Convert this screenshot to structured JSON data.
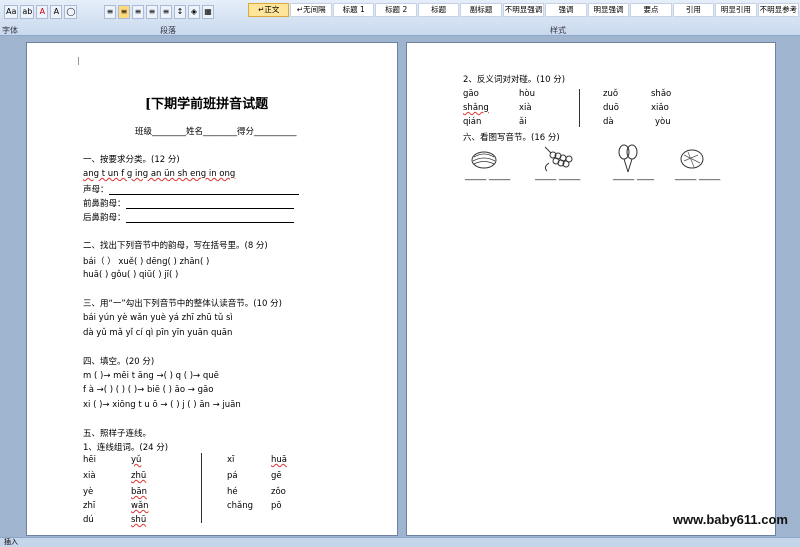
{
  "ribbon": {
    "group_font": "字体",
    "group_para": "段落",
    "group_styles": "样式",
    "font_tools": [
      "Aa",
      "ab",
      "A",
      "A"
    ],
    "styles": [
      "↵正文",
      "↵无间隔",
      "标题 1",
      "标题 2",
      "标题",
      "副标题",
      "不明显强调",
      "强调",
      "明显强调",
      "要点",
      "引用",
      "明显引用",
      "不明显参考"
    ]
  },
  "page1": {
    "title": "[下期学前班拼音试题",
    "info": "班级________姓名________得分__________",
    "s1_head": "一、按要求分类。(12 分)",
    "s1_items": "ang   t   un  f   g   ing    an    ün    sh   eng    in   ong",
    "s1_l1": "声母：",
    "s1_l2": "前鼻韵母：",
    "s1_l3": "后鼻韵母：",
    "s2_head": "二、找出下列音节中的韵母，写在括号里。(8 分)",
    "s2_r1": "bái（    ）     xuě(    )     dēng(    )      zhān(    )",
    "s2_r2": "huā(    )      gǒu(    )      qiū(    )        jī(    )",
    "s3_head": "三、用“一”勾出下列音节中的整体认读音节。(10 分)",
    "s3_r1": "bái yún         yè wǎn         yuè yá         zhī zhū          tǔ sì",
    "s3_r2": "dà yǔ            mǎ yǐ           cí qì           pīn yīn           yuān quān",
    "s4_head": "四、填空。(20 分)",
    "s4_r1": "m   (    )→ mēi          t   āng →(    )           q  (    )→ quē",
    "s4_r2": "f   à →(    )           (   ) (   )→ biē          (    )   āo → gāo",
    "s4_r3": "xi  (    )→ xiōng        t  u   ō → (    )          j  (    )  ān → juān",
    "s5_head": "五、照样子连线。",
    "s5_sub": "1、连线组词。(24 分)",
    "match_left": [
      "hēi",
      "xià",
      "yè",
      "zhī",
      "dú"
    ],
    "match_mid": [
      "yǔ",
      "zhū",
      "bān",
      "wǎn",
      "shū"
    ],
    "match_r1": [
      "xī",
      "pá",
      "hé",
      "chǎng"
    ],
    "match_r2": [
      "huā",
      "gē",
      "zǒo",
      "pō"
    ]
  },
  "page2": {
    "s2_head": "2、反义词对对碰。(10 分)",
    "ant_l1": [
      "gāo",
      "shǎng",
      "qián"
    ],
    "ant_l2": [
      "hòu",
      "xià",
      "ǎi"
    ],
    "ant_r1": [
      "zuǒ",
      "duō",
      "dà"
    ],
    "ant_r2": [
      "shǎo",
      "xiǎo",
      "yòu"
    ],
    "s6_head": "六、看图写音节。(16 分)",
    "pics": [
      "watermelon-picture",
      "grapes-picture",
      "balloons-picture",
      "bowl-picture"
    ]
  },
  "status": {
    "mode": "插入"
  },
  "watermark": "www.baby611.com"
}
